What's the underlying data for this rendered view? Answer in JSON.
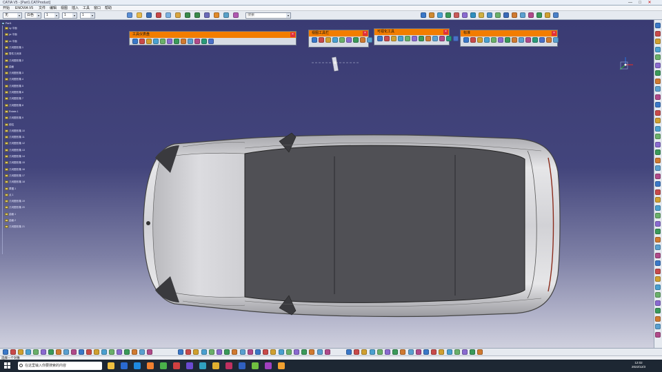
{
  "window": {
    "title": "CATIA V5 - [Part1.CATProduct]",
    "min": "—",
    "max": "□",
    "close": "✕"
  },
  "menu": [
    "开始",
    "ENOVIA V5",
    "文件",
    "编辑",
    "视图",
    "插入",
    "工具",
    "窗口",
    "帮助"
  ],
  "ribbon": {
    "combos": [
      "无",
      "白色",
      "1",
      "1",
      "1"
    ],
    "search_placeholder": "搜索",
    "icons": [
      {
        "name": "new-icon",
        "color": "#5b8fd6"
      },
      {
        "name": "open-icon",
        "color": "#e6b84a"
      },
      {
        "name": "save-icon",
        "color": "#3b6fb6"
      },
      {
        "name": "cut-icon",
        "color": "#c64848"
      },
      {
        "name": "copy-icon",
        "color": "#7ab0e0"
      },
      {
        "name": "paste-icon",
        "color": "#d9a640"
      },
      {
        "name": "undo-icon",
        "color": "#3a8a4a"
      },
      {
        "name": "redo-icon",
        "color": "#3a8a4a"
      },
      {
        "name": "measure-icon",
        "color": "#6a6ab8"
      },
      {
        "name": "snap-icon",
        "color": "#e08a2a"
      },
      {
        "name": "view-icon",
        "color": "#5aa0c8"
      },
      {
        "name": "render-icon",
        "color": "#b05ab0"
      }
    ],
    "right_icons": [
      {
        "name": "sketch-icon",
        "color": "#3a78c8"
      },
      {
        "name": "pad-icon",
        "color": "#d08a30"
      },
      {
        "name": "pocket-icon",
        "color": "#4aa0d0"
      },
      {
        "name": "shaft-icon",
        "color": "#3a9a5a"
      },
      {
        "name": "groove-icon",
        "color": "#c85a5a"
      },
      {
        "name": "hole-icon",
        "color": "#8a6ad0"
      },
      {
        "name": "fillet-icon",
        "color": "#2f8fbf"
      },
      {
        "name": "chamfer-icon",
        "color": "#d0b040"
      },
      {
        "name": "draft-icon",
        "color": "#4a90c8"
      },
      {
        "name": "shell-icon",
        "color": "#6ab06a"
      },
      {
        "name": "mirror-icon",
        "color": "#3a6ab8"
      },
      {
        "name": "pattern-icon",
        "color": "#d07a30"
      },
      {
        "name": "scale-icon",
        "color": "#5aa0d0"
      },
      {
        "name": "split-icon",
        "color": "#b04a8a"
      },
      {
        "name": "join-icon",
        "color": "#3a9a5a"
      },
      {
        "name": "sweep-icon",
        "color": "#d0a030"
      },
      {
        "name": "loft-icon",
        "color": "#4a80c8"
      }
    ]
  },
  "tree": {
    "root": "Part1",
    "items": [
      "xy 平面",
      "yz 平面",
      "zx 平面",
      "几何图形集.1",
      "零件几何体",
      "几何图形集.2",
      "曲面",
      "几何图形集.3",
      "几何图形集.4",
      "几何图形集.5",
      "几何图形集.6",
      "几何图形集.7",
      "几何图形集.8",
      "Rotate.1",
      "几何图形集.9",
      "前柱",
      "几何图形集.10",
      "几何图形集.11",
      "几何图形集.12",
      "几何图形集.13",
      "几何图形集.14",
      "几何图形集.15",
      "几何图形集.16",
      "几何图形集.17",
      "几何图形集.18",
      "草图.1",
      "点.1",
      "几何图形集.19",
      "几何图形集.20",
      "曲面.1",
      "曲面.2",
      "几何图形集.21"
    ]
  },
  "panels": [
    {
      "title": "工具仪表盘",
      "icons": [
        "#3a78c8",
        "#c84a4a",
        "#d0a030",
        "#4aa0d0",
        "#6ab06a",
        "#8a6ad0",
        "#3a9a5a",
        "#d07a30",
        "#5aa0d0",
        "#b04a8a",
        "#2a9a7a",
        "#4a70c8"
      ]
    },
    {
      "title": "视图工具栏",
      "icons": [
        "#3a78c8",
        "#c84a4a",
        "#d0a030",
        "#4aa0d0",
        "#6ab06a",
        "#8a6ad0",
        "#3a9a5a",
        "#d07a30",
        "#5aa0d0",
        "#b04a8a"
      ]
    },
    {
      "title": "可视化工具",
      "icons": [
        "#3a78c8",
        "#c84a4a",
        "#d0a030",
        "#4aa0d0",
        "#6ab06a",
        "#8a6ad0",
        "#3a9a5a",
        "#d07a30",
        "#5aa0d0",
        "#b04a8a",
        "#2a9a7a",
        "#4a70c8"
      ]
    },
    {
      "title": "标准",
      "icons": [
        "#3a78c8",
        "#c84a4a",
        "#d0a030",
        "#4aa0d0",
        "#6ab06a",
        "#8a6ad0",
        "#3a9a5a",
        "#d07a30",
        "#5aa0d0",
        "#b04a8a",
        "#2a9a7a",
        "#4a70c8",
        "#d07a30",
        "#5aa0d0"
      ]
    }
  ],
  "status": "选择一个对象",
  "taskbar": {
    "search": "在这里输入你要搜索的内容",
    "time": "12:02",
    "date": "2022/12/3",
    "apps": [
      "#f0c040",
      "#2a6ad0",
      "#1e8ae0",
      "#f08030",
      "#4ab04a",
      "#d04040",
      "#6a4ad0",
      "#30a0c0",
      "#e0b030",
      "#c03060",
      "#3060c0",
      "#70c040",
      "#a040c0",
      "#f0a030"
    ]
  },
  "colors": {
    "accent": "#f27d00",
    "viewport_top": "#3a3b73",
    "viewport_bottom": "#cfd0de"
  }
}
